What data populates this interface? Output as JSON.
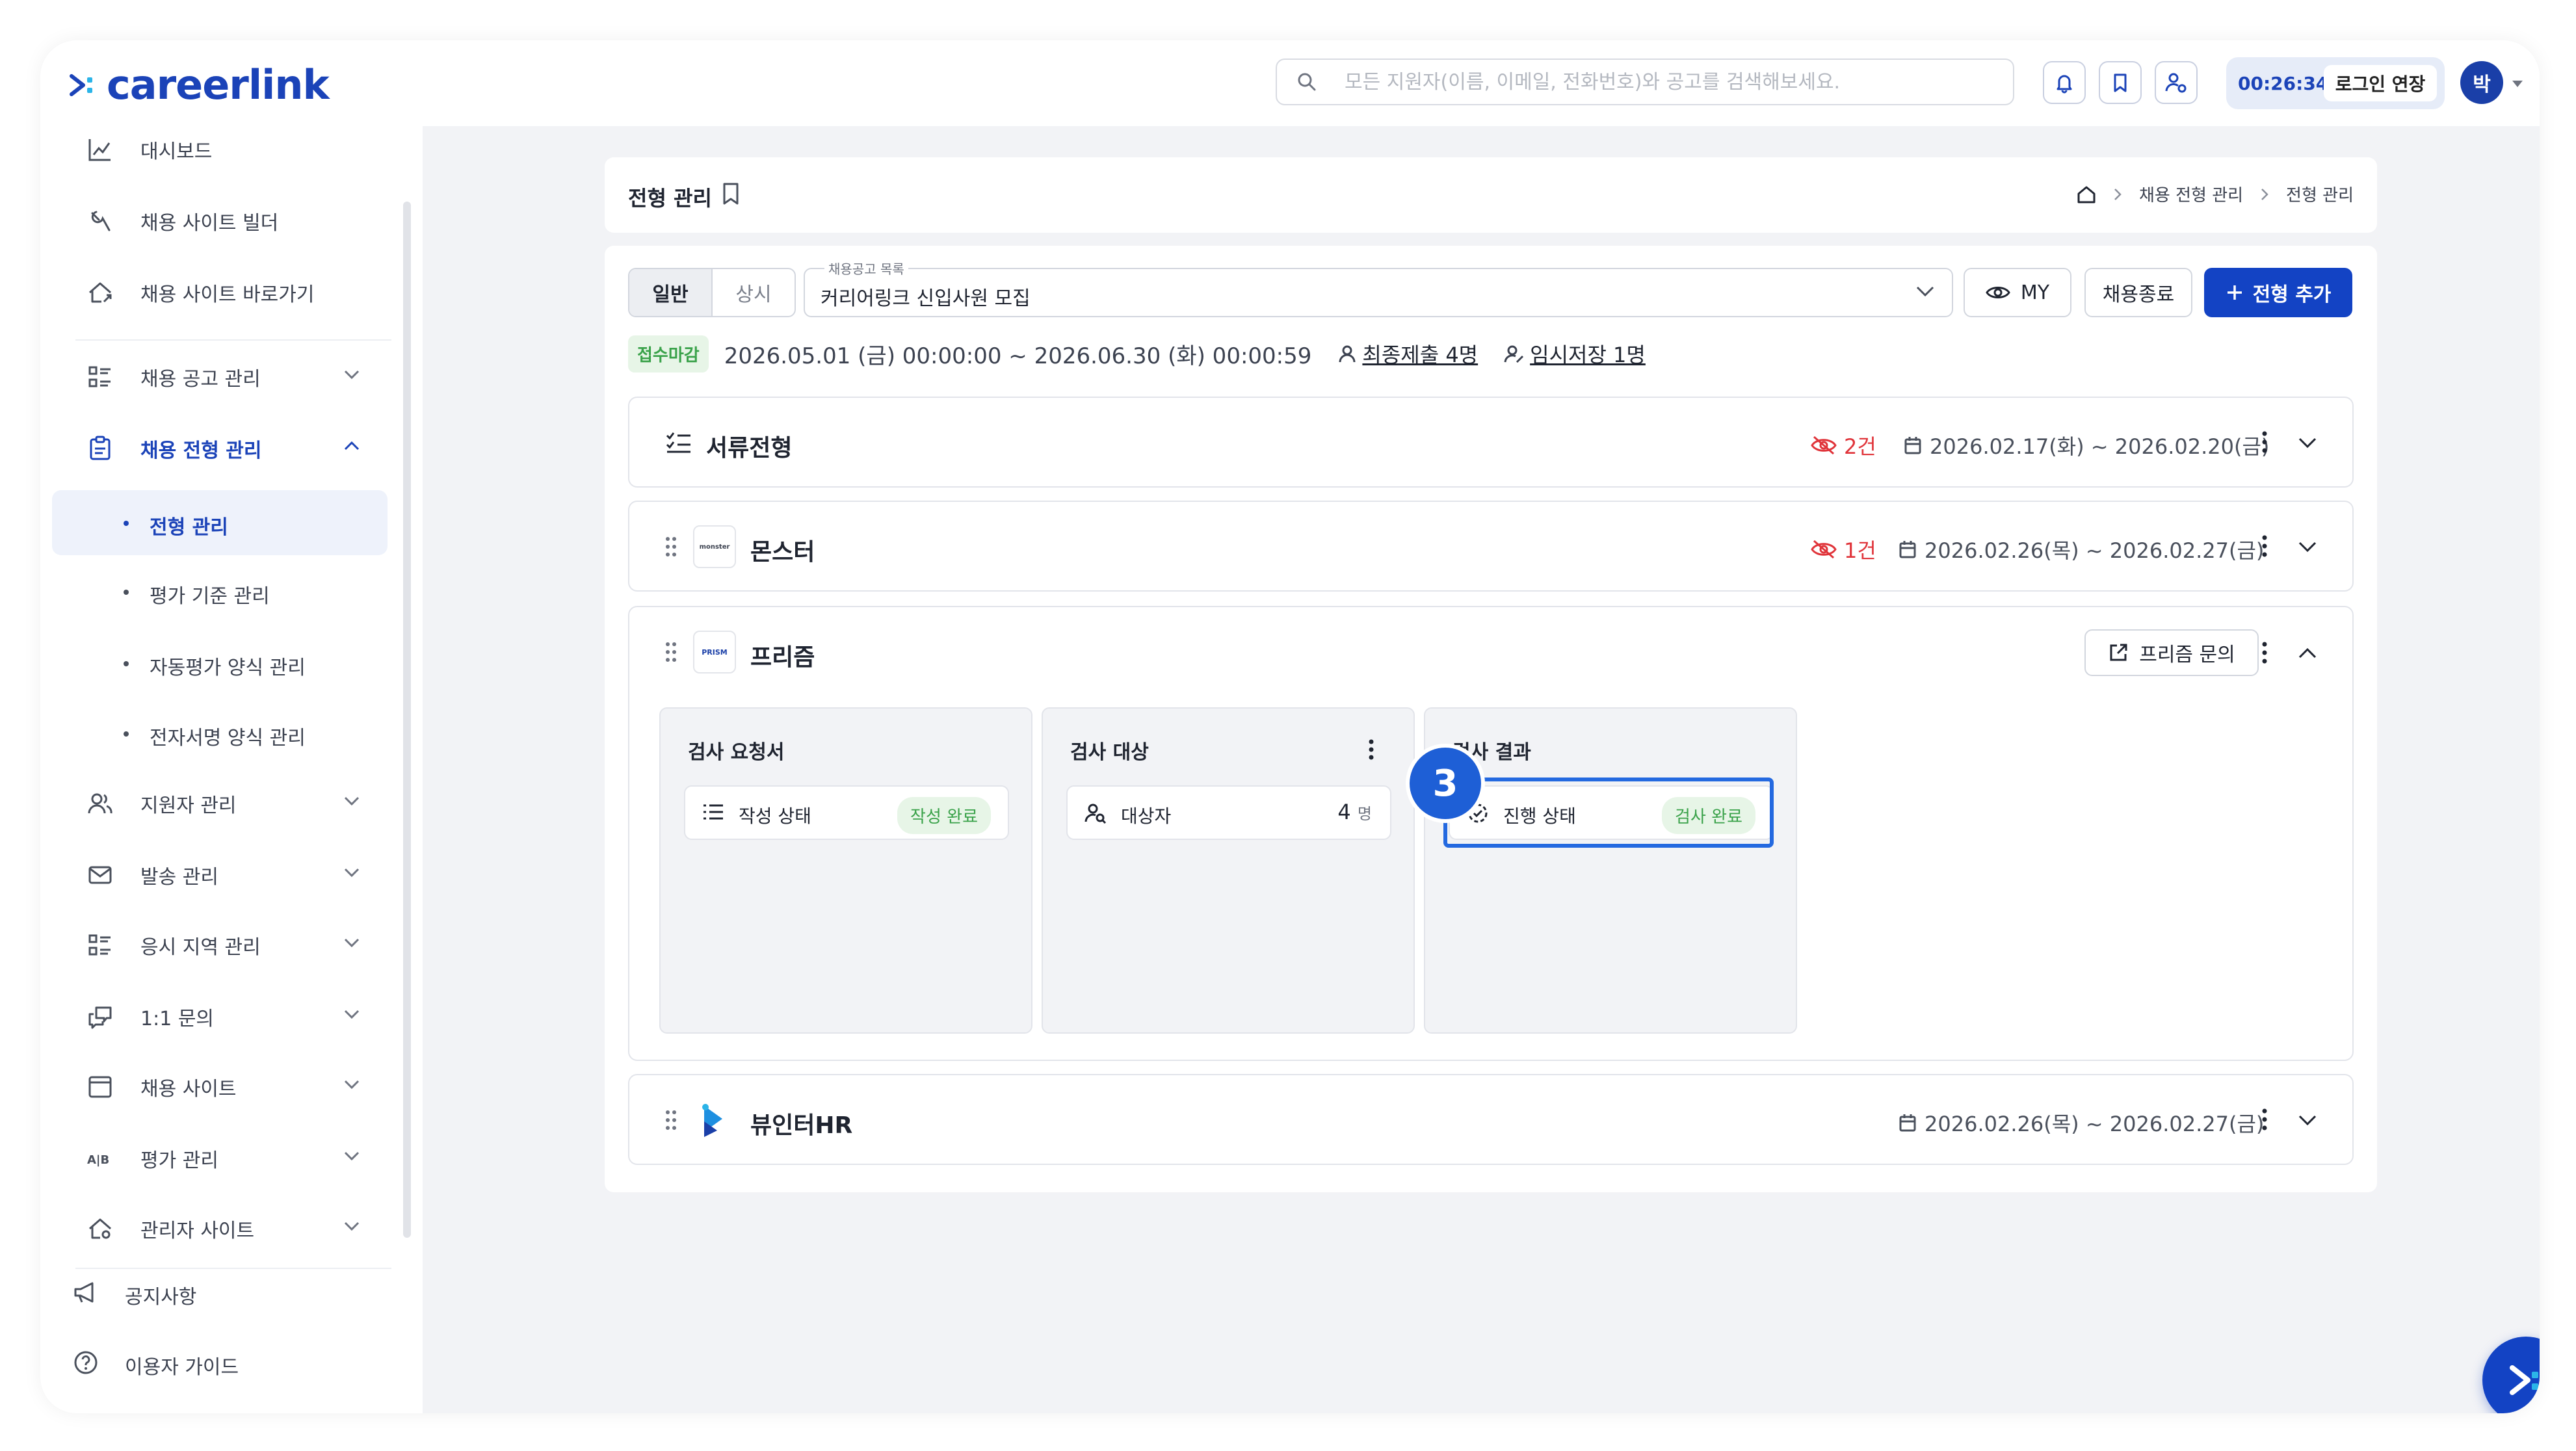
{
  "app": {
    "logo": "careerlink"
  },
  "topbar": {
    "search_placeholder": "모든 지원자(이름, 이메일, 전화번호)와 공고를 검색해보세요.",
    "session_timer": "00:26:34",
    "extend_label": "로그인 연장",
    "avatar_initial": "박"
  },
  "sidebar": {
    "items": [
      {
        "label": "대시보드"
      },
      {
        "label": "채용 사이트 빌더"
      },
      {
        "label": "채용 사이트 바로가기"
      },
      {
        "label": "채용 공고 관리"
      },
      {
        "label": "채용 전형 관리"
      },
      {
        "label": "지원자 관리"
      },
      {
        "label": "발송 관리"
      },
      {
        "label": "응시 지역 관리"
      },
      {
        "label": "1:1 문의"
      },
      {
        "label": "채용 사이트"
      },
      {
        "label": "평가 관리"
      },
      {
        "label": "관리자 사이트"
      }
    ],
    "subitems": [
      {
        "label": "전형 관리"
      },
      {
        "label": "평가 기준 관리"
      },
      {
        "label": "자동평가 양식 관리"
      },
      {
        "label": "전자서명 양식 관리"
      }
    ],
    "footer": [
      {
        "label": "공지사항"
      },
      {
        "label": "이용자 가이드"
      }
    ]
  },
  "header": {
    "title": "전형 관리",
    "breadcrumb": [
      "채용 전형 관리",
      "전형 관리"
    ]
  },
  "filters": {
    "segment": [
      "일반",
      "상시"
    ],
    "posting_label": "채용공고 목록",
    "posting_value": "커리어링크 신입사원 모집",
    "my_label": "MY",
    "close_label": "채용종료",
    "add_label": "전형 추가"
  },
  "info": {
    "status": "접수마감",
    "period": "2026.05.01 (금) 00:00:00 ~ 2026.06.30 (화) 00:00:59",
    "final_submit": "최종제출 4명",
    "temp_saved": "임시저장 1명"
  },
  "stages": [
    {
      "name": "서류전형",
      "hidden_count": "2건",
      "date_range": "2026.02.17(화) ~ 2026.02.20(금)"
    },
    {
      "name": "몬스터",
      "logo_text": "monster",
      "hidden_count": "1건",
      "date_range": "2026.02.26(목) ~ 2026.02.27(금)"
    },
    {
      "name": "프리즘",
      "logo_text": "PRISM",
      "inquiry_label": "프리즘 문의",
      "panels": [
        {
          "title": "검사 요청서",
          "field_label": "작성 상태",
          "status": "작성 완료"
        },
        {
          "title": "검사 대상",
          "field_label": "대상자",
          "count": "4",
          "unit": "명"
        },
        {
          "title": "검사 결과",
          "field_label": "진행 상태",
          "status": "검사 완료"
        }
      ]
    },
    {
      "name": "뷰인터HR",
      "date_range": "2026.02.26(목) ~ 2026.02.27(금)"
    }
  ],
  "annotation": {
    "step": "3"
  },
  "colors": {
    "brand": "#1343c4",
    "success": "#3aa24a",
    "danger": "#e0343a",
    "highlight": "#2469e0"
  }
}
